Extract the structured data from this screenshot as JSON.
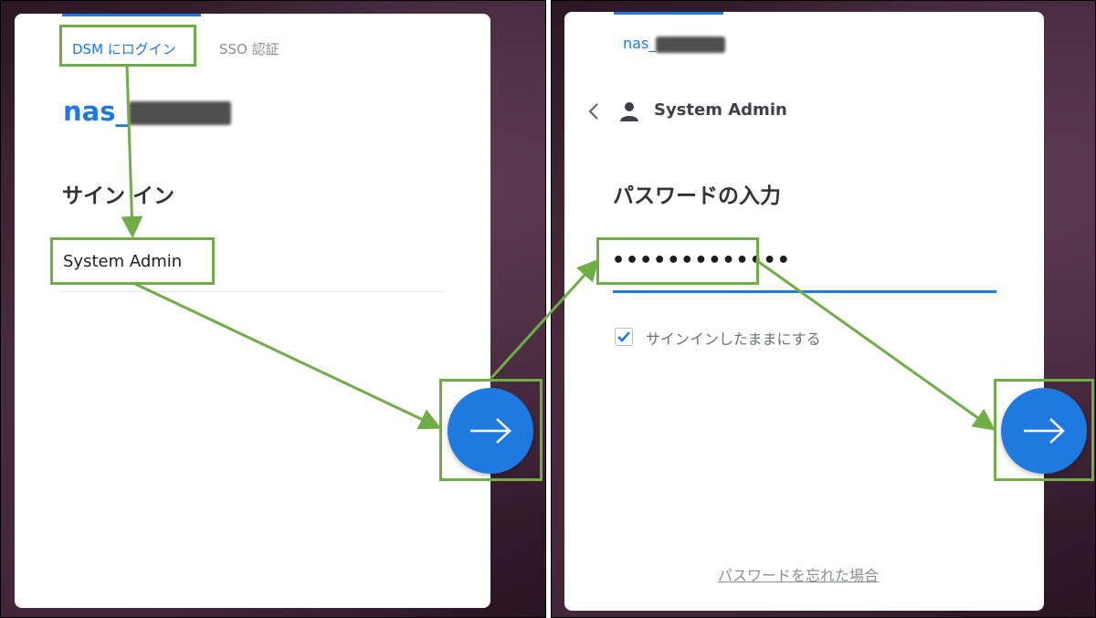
{
  "left_panel": {
    "tabs": [
      {
        "label": "DSM にログイン",
        "active": true
      },
      {
        "label": "SSO 認証",
        "active": false
      }
    ],
    "hostname": "nas_",
    "heading": "サイン イン",
    "username_value": "System Admin"
  },
  "right_panel": {
    "hostname": "nas_",
    "account_name": "System Admin",
    "heading": "パスワードの入力",
    "password_value": "•••••••••••••",
    "remember_label": "サインインしたままにする",
    "remember_checked": true,
    "forgot_link": "パスワードを忘れた場合"
  },
  "colors": {
    "accent": "#1f7ae0",
    "annotation": "#70ad47",
    "muted_text": "#8a8f96"
  },
  "icons": {
    "next": "arrow-right-icon",
    "back": "chevron-left-icon",
    "user": "user-icon",
    "check": "checkmark-icon"
  }
}
